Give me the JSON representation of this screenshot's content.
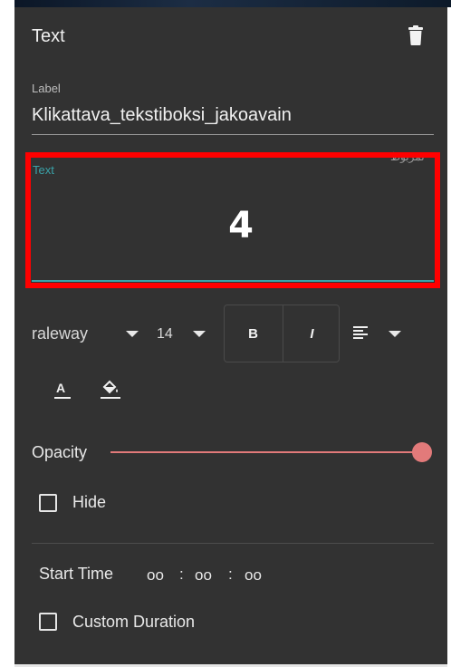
{
  "panel": {
    "title": "Text",
    "delete_icon": "trash-icon"
  },
  "label_field": {
    "caption": "Label",
    "value": "Klikattava_tekstiboksi_jakoavain"
  },
  "text_field": {
    "caption": "Text",
    "value": "4",
    "language_hint": "ںمربوط"
  },
  "toolbar": {
    "font_family": "raleway",
    "font_size": "14",
    "bold_label": "B",
    "italic_label": "I",
    "align_icon": "align-left-icon",
    "text_color_label": "A",
    "fill_icon": "paint-bucket-icon"
  },
  "opacity": {
    "label": "Opacity",
    "value": 1.0
  },
  "hide": {
    "label": "Hide",
    "checked": false
  },
  "start_time": {
    "label": "Start Time",
    "hours": "oo",
    "minutes": "oo",
    "seconds": "oo",
    "separator": ":"
  },
  "custom_duration": {
    "label": "Custom Duration",
    "checked": false
  },
  "colors": {
    "panel_bg": "#323232",
    "accent_teal": "#3aa2a8",
    "slider": "#e27a7a",
    "highlight_border": "#ff0000"
  }
}
